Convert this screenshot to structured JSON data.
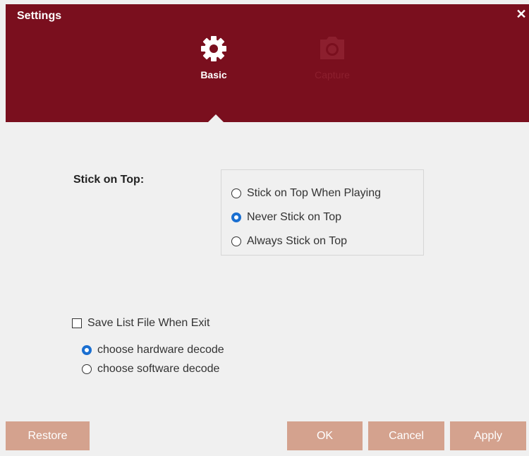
{
  "window": {
    "title": "Settings",
    "close_label": "✕"
  },
  "tabs": [
    {
      "label": "Basic",
      "icon": "gear-icon",
      "active": true
    },
    {
      "label": "Capture",
      "icon": "camera-icon",
      "active": false
    }
  ],
  "stick_on_top": {
    "label": "Stick on Top:",
    "options": [
      {
        "label": "Stick on Top When Playing",
        "checked": false
      },
      {
        "label": "Never Stick on Top",
        "checked": true
      },
      {
        "label": "Always Stick on Top",
        "checked": false
      }
    ]
  },
  "save_list": {
    "label": "Save List File When Exit",
    "checked": false
  },
  "decode": {
    "options": [
      {
        "label": "choose hardware decode",
        "checked": true
      },
      {
        "label": "choose software decode",
        "checked": false
      }
    ]
  },
  "buttons": {
    "restore": "Restore",
    "ok": "OK",
    "cancel": "Cancel",
    "apply": "Apply"
  },
  "colors": {
    "header_bg": "#7a0f1e",
    "button_bg": "#d4a28e",
    "radio_checked": "#1a6fd1"
  }
}
